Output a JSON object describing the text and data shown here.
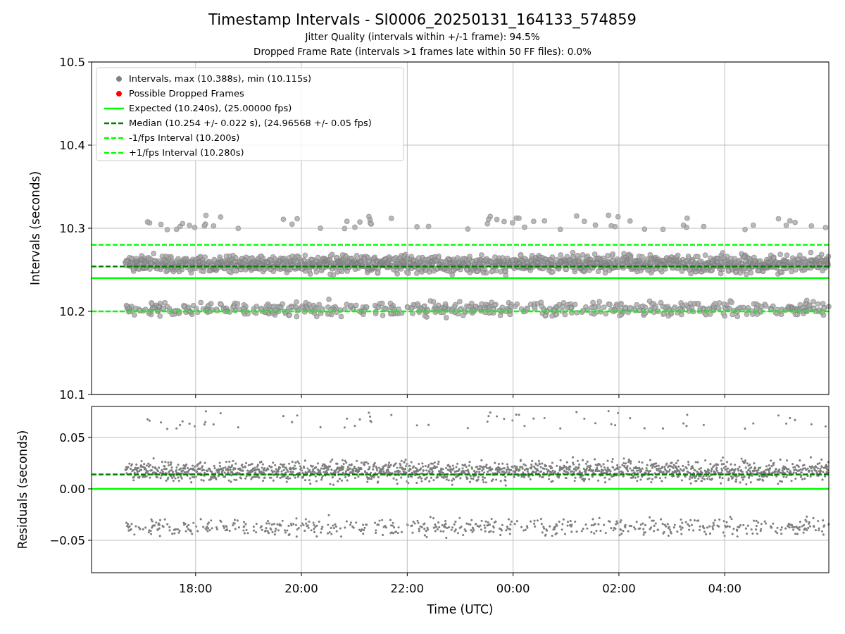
{
  "figure": {
    "title": "Timestamp Intervals - SI0006_20250131_164133_574859",
    "subtitles": [
      "Jitter Quality (intervals within +/-1 frame): 94.5%",
      "Dropped Frame Rate (intervals >1 frames late within 50 FF files): 0.0%"
    ]
  },
  "top_chart": {
    "legend_markers": [
      {
        "label": "Intervals, max (10.388s), min (10.115s)",
        "color": "#808080"
      },
      {
        "label": "Possible Dropped Frames",
        "color": "#ff0000"
      }
    ],
    "chart_data": {
      "type": "line",
      "ylabel": "Intervals (seconds)",
      "grid": true,
      "legend": true,
      "x": [
        "2025-01-31T16:02",
        "2025-02-01T05:58"
      ],
      "xlim": [
        "2025-01-31T16:02",
        "2025-02-01T05:58"
      ],
      "ylim": [
        10.1,
        10.5
      ],
      "yticks": [
        {
          "value": 10.1,
          "label": "10.1"
        },
        {
          "value": 10.2,
          "label": "10.2"
        },
        {
          "value": 10.3,
          "label": "10.3"
        },
        {
          "value": 10.4,
          "label": "10.4"
        },
        {
          "value": 10.5,
          "label": "10.5"
        }
      ],
      "series": [
        {
          "name": "Expected (10.240s), (25.00000 fps)",
          "color": "#00ff00",
          "line_style": "solid",
          "values": [
            10.24,
            10.24
          ]
        },
        {
          "name": "Median (10.254 +/- 0.022 s), (24.96568 +/- 0.05 fps)",
          "color": "#008000",
          "line_style": "dashed",
          "values": [
            10.254,
            10.254
          ]
        },
        {
          "name": "-1/fps Interval (10.200s)",
          "color": "#00ff00",
          "line_style": "dashed",
          "values": [
            10.2,
            10.2
          ]
        },
        {
          "name": "+1/fps Interval (10.280s)",
          "color": "#00ff00",
          "line_style": "dashed",
          "values": [
            10.28,
            10.28
          ]
        }
      ]
    }
  },
  "bottom_chart": {
    "chart_data": {
      "type": "line",
      "xlabel": "Time (UTC)",
      "ylabel": "Residuals (seconds)",
      "grid": true,
      "x": [
        "2025-01-31T16:02",
        "2025-02-01T05:58"
      ],
      "xlim": [
        "2025-01-31T16:02",
        "2025-02-01T05:58"
      ],
      "ylim": [
        -0.0815,
        0.0801
      ],
      "yticks": [
        {
          "value": -0.05,
          "label": "−0.05"
        },
        {
          "value": 0,
          "label": "0.00"
        },
        {
          "value": 0.05,
          "label": "0.05"
        }
      ],
      "xticks": [
        {
          "value": "2025-01-31T18:00",
          "label": "18:00"
        },
        {
          "value": "2025-01-31T20:00",
          "label": "20:00"
        },
        {
          "value": "2025-01-31T22:00",
          "label": "22:00"
        },
        {
          "value": "2025-02-01T00:00",
          "label": "00:00"
        },
        {
          "value": "2025-02-01T02:00",
          "label": "02:00"
        },
        {
          "value": "2025-02-01T04:00",
          "label": "04:00"
        }
      ],
      "series": [
        {
          "color": "#00ff00",
          "line_style": "solid",
          "values": [
            0,
            0
          ]
        },
        {
          "color": "#008000",
          "line_style": "dashed",
          "values": [
            0.014,
            0.014
          ]
        }
      ]
    }
  }
}
